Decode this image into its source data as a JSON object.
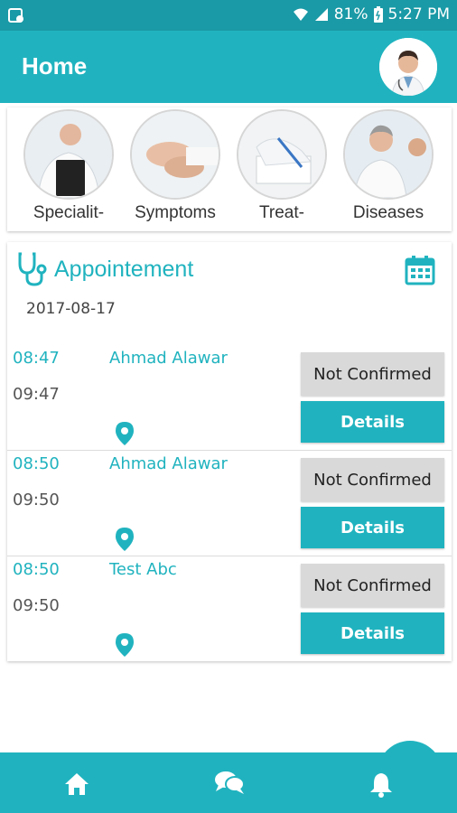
{
  "status_bar": {
    "battery": "81%",
    "time": "5:27 PM"
  },
  "header": {
    "title": "Home"
  },
  "categories": [
    {
      "label": "Specialit-",
      "image": "doctor-clipboard"
    },
    {
      "label": "Symptoms",
      "image": "hands-examination"
    },
    {
      "label": "Treat-",
      "image": "prescription-writing"
    },
    {
      "label": "Diseases",
      "image": "doctor-patient"
    }
  ],
  "appointments": {
    "title": "Appointement",
    "date": "2017-08-17",
    "items": [
      {
        "start": "08:47",
        "end": "09:47",
        "name": "Ahmad Alawar",
        "status": "Not Confirmed",
        "details_label": "Details"
      },
      {
        "start": "08:50",
        "end": "09:50",
        "name": "Ahmad Alawar",
        "status": "Not Confirmed",
        "details_label": "Details"
      },
      {
        "start": "08:50",
        "end": "09:50",
        "name": "Test Abc",
        "status": "Not Confirmed",
        "details_label": "Details"
      }
    ]
  },
  "bottom_nav": [
    {
      "icon": "home-icon"
    },
    {
      "icon": "chat-icon"
    },
    {
      "icon": "bell-icon"
    }
  ],
  "colors": {
    "primary": "#20b3bf",
    "status_bar": "#1a9aa6",
    "status_button": "#d9d9d9"
  }
}
